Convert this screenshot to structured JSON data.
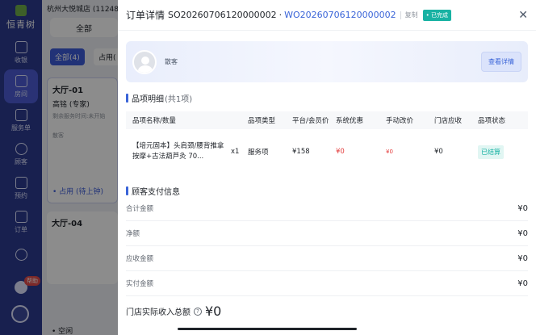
{
  "nav": {
    "logo_text": "恒青树",
    "items": [
      {
        "label": "收银",
        "icon": "cashier-monitor-icon"
      },
      {
        "label": "房间",
        "icon": "home-icon"
      },
      {
        "label": "服务单",
        "icon": "service-order-icon"
      },
      {
        "label": "顾客",
        "icon": "customer-icon"
      },
      {
        "label": "预约",
        "icon": "calendar-icon"
      },
      {
        "label": "订单",
        "icon": "order-list-icon"
      },
      {
        "label": "",
        "icon": "people-icon"
      }
    ],
    "help_badge": "帮助"
  },
  "background": {
    "store_name": "杭州大悦城店  (11248",
    "tab_all": "全部",
    "chip_all": "全部(4)",
    "chip_occupied": "占用(",
    "room1": {
      "title": "大厅-01",
      "staff": "高铭 (专家)",
      "meta": "剩余服务时间:未开始",
      "note": "散客",
      "status": "• 占用 (待上钟)"
    },
    "room2": {
      "title": "大厅-04"
    },
    "free_label": "• 空闲"
  },
  "modal": {
    "title": "订单详情",
    "so_number": "SO20260706120000002",
    "separator": "·",
    "wo_number": "WO20260706120000002",
    "copy_label": "复制",
    "status_badge": "• 已完成",
    "close_glyph": "✕",
    "customer": {
      "name": "散客",
      "view_button": "查看详情"
    },
    "items_section": {
      "title": "品项明细",
      "count": "(共1项)"
    },
    "table": {
      "headers": [
        "品项名称/数量",
        "品项类型",
        "平台/会员价",
        "系统优惠",
        "手动改价",
        "门店应收",
        "品项状态"
      ],
      "rows": [
        {
          "name": "【培元固本】头肩颈/腰背推拿按摩+古法葫芦灸 70...",
          "qty": "x1",
          "type": "服务项",
          "price": "¥158",
          "system_discount": "¥0",
          "manual_change": "¥0",
          "receivable": "¥0",
          "status": "已结算"
        }
      ]
    },
    "payment_section": {
      "title": "顾客支付信息"
    },
    "payment_rows": [
      {
        "label": "合计金额",
        "value": "¥0"
      },
      {
        "label": "净额",
        "value": "¥0"
      },
      {
        "label": "应收金额",
        "value": "¥0"
      },
      {
        "label": "实付金额",
        "value": "¥0"
      }
    ],
    "income": {
      "label": "门店实际收入总额",
      "help": "?",
      "amount": "¥0"
    }
  }
}
